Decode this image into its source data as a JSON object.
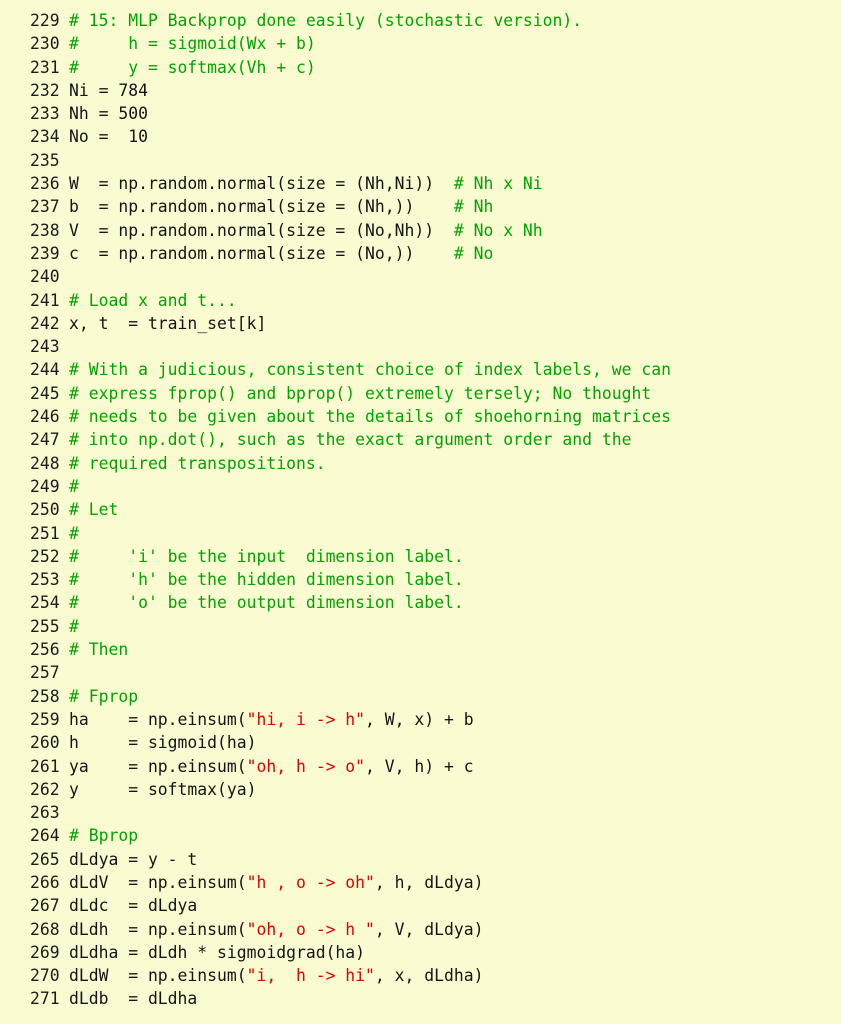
{
  "document": {
    "kind": "python-source-listing",
    "colors": {
      "background": "#fbfbd2",
      "line_number": "#1b1b1b",
      "plain_text": "#141414",
      "comment": "#00a400",
      "string": "#e40000"
    },
    "first_line_number": 229,
    "last_line_number": 271
  },
  "lines": [
    {
      "n": "229",
      "segments": [
        {
          "t": "comment",
          "s": "# 15: MLP Backprop done easily (stochastic version)."
        }
      ]
    },
    {
      "n": "230",
      "segments": [
        {
          "t": "comment",
          "s": "#     h = sigmoid(Wx + b)"
        }
      ]
    },
    {
      "n": "231",
      "segments": [
        {
          "t": "comment",
          "s": "#     y = softmax(Vh + c)"
        }
      ]
    },
    {
      "n": "232",
      "segments": [
        {
          "t": "plain",
          "s": "Ni = 784"
        }
      ]
    },
    {
      "n": "233",
      "segments": [
        {
          "t": "plain",
          "s": "Nh = 500"
        }
      ]
    },
    {
      "n": "234",
      "segments": [
        {
          "t": "plain",
          "s": "No =  10"
        }
      ]
    },
    {
      "n": "235",
      "segments": [
        {
          "t": "plain",
          "s": ""
        }
      ]
    },
    {
      "n": "236",
      "segments": [
        {
          "t": "plain",
          "s": "W  = np.random.normal(size = (Nh,Ni))  "
        },
        {
          "t": "comment",
          "s": "# Nh x Ni"
        }
      ]
    },
    {
      "n": "237",
      "segments": [
        {
          "t": "plain",
          "s": "b  = np.random.normal(size = (Nh,))    "
        },
        {
          "t": "comment",
          "s": "# Nh"
        }
      ]
    },
    {
      "n": "238",
      "segments": [
        {
          "t": "plain",
          "s": "V  = np.random.normal(size = (No,Nh))  "
        },
        {
          "t": "comment",
          "s": "# No x Nh"
        }
      ]
    },
    {
      "n": "239",
      "segments": [
        {
          "t": "plain",
          "s": "c  = np.random.normal(size = (No,))    "
        },
        {
          "t": "comment",
          "s": "# No"
        }
      ]
    },
    {
      "n": "240",
      "segments": [
        {
          "t": "plain",
          "s": ""
        }
      ]
    },
    {
      "n": "241",
      "segments": [
        {
          "t": "comment",
          "s": "# Load x and t..."
        }
      ]
    },
    {
      "n": "242",
      "segments": [
        {
          "t": "plain",
          "s": "x, t  = train_set[k]"
        }
      ]
    },
    {
      "n": "243",
      "segments": [
        {
          "t": "plain",
          "s": ""
        }
      ]
    },
    {
      "n": "244",
      "segments": [
        {
          "t": "comment",
          "s": "# With a judicious, consistent choice of index labels, we can"
        }
      ]
    },
    {
      "n": "245",
      "segments": [
        {
          "t": "comment",
          "s": "# express fprop() and bprop() extremely tersely; No thought"
        }
      ]
    },
    {
      "n": "246",
      "segments": [
        {
          "t": "comment",
          "s": "# needs to be given about the details of shoehorning matrices"
        }
      ]
    },
    {
      "n": "247",
      "segments": [
        {
          "t": "comment",
          "s": "# into np.dot(), such as the exact argument order and the"
        }
      ]
    },
    {
      "n": "248",
      "segments": [
        {
          "t": "comment",
          "s": "# required transpositions."
        }
      ]
    },
    {
      "n": "249",
      "segments": [
        {
          "t": "comment",
          "s": "#"
        }
      ]
    },
    {
      "n": "250",
      "segments": [
        {
          "t": "comment",
          "s": "# Let"
        }
      ]
    },
    {
      "n": "251",
      "segments": [
        {
          "t": "comment",
          "s": "#"
        }
      ]
    },
    {
      "n": "252",
      "segments": [
        {
          "t": "comment",
          "s": "#     'i' be the input  dimension label."
        }
      ]
    },
    {
      "n": "253",
      "segments": [
        {
          "t": "comment",
          "s": "#     'h' be the hidden dimension label."
        }
      ]
    },
    {
      "n": "254",
      "segments": [
        {
          "t": "comment",
          "s": "#     'o' be the output dimension label."
        }
      ]
    },
    {
      "n": "255",
      "segments": [
        {
          "t": "comment",
          "s": "#"
        }
      ]
    },
    {
      "n": "256",
      "segments": [
        {
          "t": "comment",
          "s": "# Then"
        }
      ]
    },
    {
      "n": "257",
      "segments": [
        {
          "t": "plain",
          "s": ""
        }
      ]
    },
    {
      "n": "258",
      "segments": [
        {
          "t": "comment",
          "s": "# Fprop"
        }
      ]
    },
    {
      "n": "259",
      "segments": [
        {
          "t": "plain",
          "s": "ha    = np.einsum("
        },
        {
          "t": "string",
          "s": "\"hi, i -> h\""
        },
        {
          "t": "plain",
          "s": ", W, x) + b"
        }
      ]
    },
    {
      "n": "260",
      "segments": [
        {
          "t": "plain",
          "s": "h     = sigmoid(ha)"
        }
      ]
    },
    {
      "n": "261",
      "segments": [
        {
          "t": "plain",
          "s": "ya    = np.einsum("
        },
        {
          "t": "string",
          "s": "\"oh, h -> o\""
        },
        {
          "t": "plain",
          "s": ", V, h) + c"
        }
      ]
    },
    {
      "n": "262",
      "segments": [
        {
          "t": "plain",
          "s": "y     = softmax(ya)"
        }
      ]
    },
    {
      "n": "263",
      "segments": [
        {
          "t": "plain",
          "s": ""
        }
      ]
    },
    {
      "n": "264",
      "segments": [
        {
          "t": "comment",
          "s": "# Bprop"
        }
      ]
    },
    {
      "n": "265",
      "segments": [
        {
          "t": "plain",
          "s": "dLdya = y - t"
        }
      ]
    },
    {
      "n": "266",
      "segments": [
        {
          "t": "plain",
          "s": "dLdV  = np.einsum("
        },
        {
          "t": "string",
          "s": "\"h , o -> oh\""
        },
        {
          "t": "plain",
          "s": ", h, dLdya)"
        }
      ]
    },
    {
      "n": "267",
      "segments": [
        {
          "t": "plain",
          "s": "dLdc  = dLdya"
        }
      ]
    },
    {
      "n": "268",
      "segments": [
        {
          "t": "plain",
          "s": "dLdh  = np.einsum("
        },
        {
          "t": "string",
          "s": "\"oh, o -> h \""
        },
        {
          "t": "plain",
          "s": ", V, dLdya)"
        }
      ]
    },
    {
      "n": "269",
      "segments": [
        {
          "t": "plain",
          "s": "dLdha = dLdh * sigmoidgrad(ha)"
        }
      ]
    },
    {
      "n": "270",
      "segments": [
        {
          "t": "plain",
          "s": "dLdW  = np.einsum("
        },
        {
          "t": "string",
          "s": "\"i,  h -> hi\""
        },
        {
          "t": "plain",
          "s": ", x, dLdha)"
        }
      ]
    },
    {
      "n": "271",
      "segments": [
        {
          "t": "plain",
          "s": "dLdb  = dLdha"
        }
      ]
    }
  ]
}
